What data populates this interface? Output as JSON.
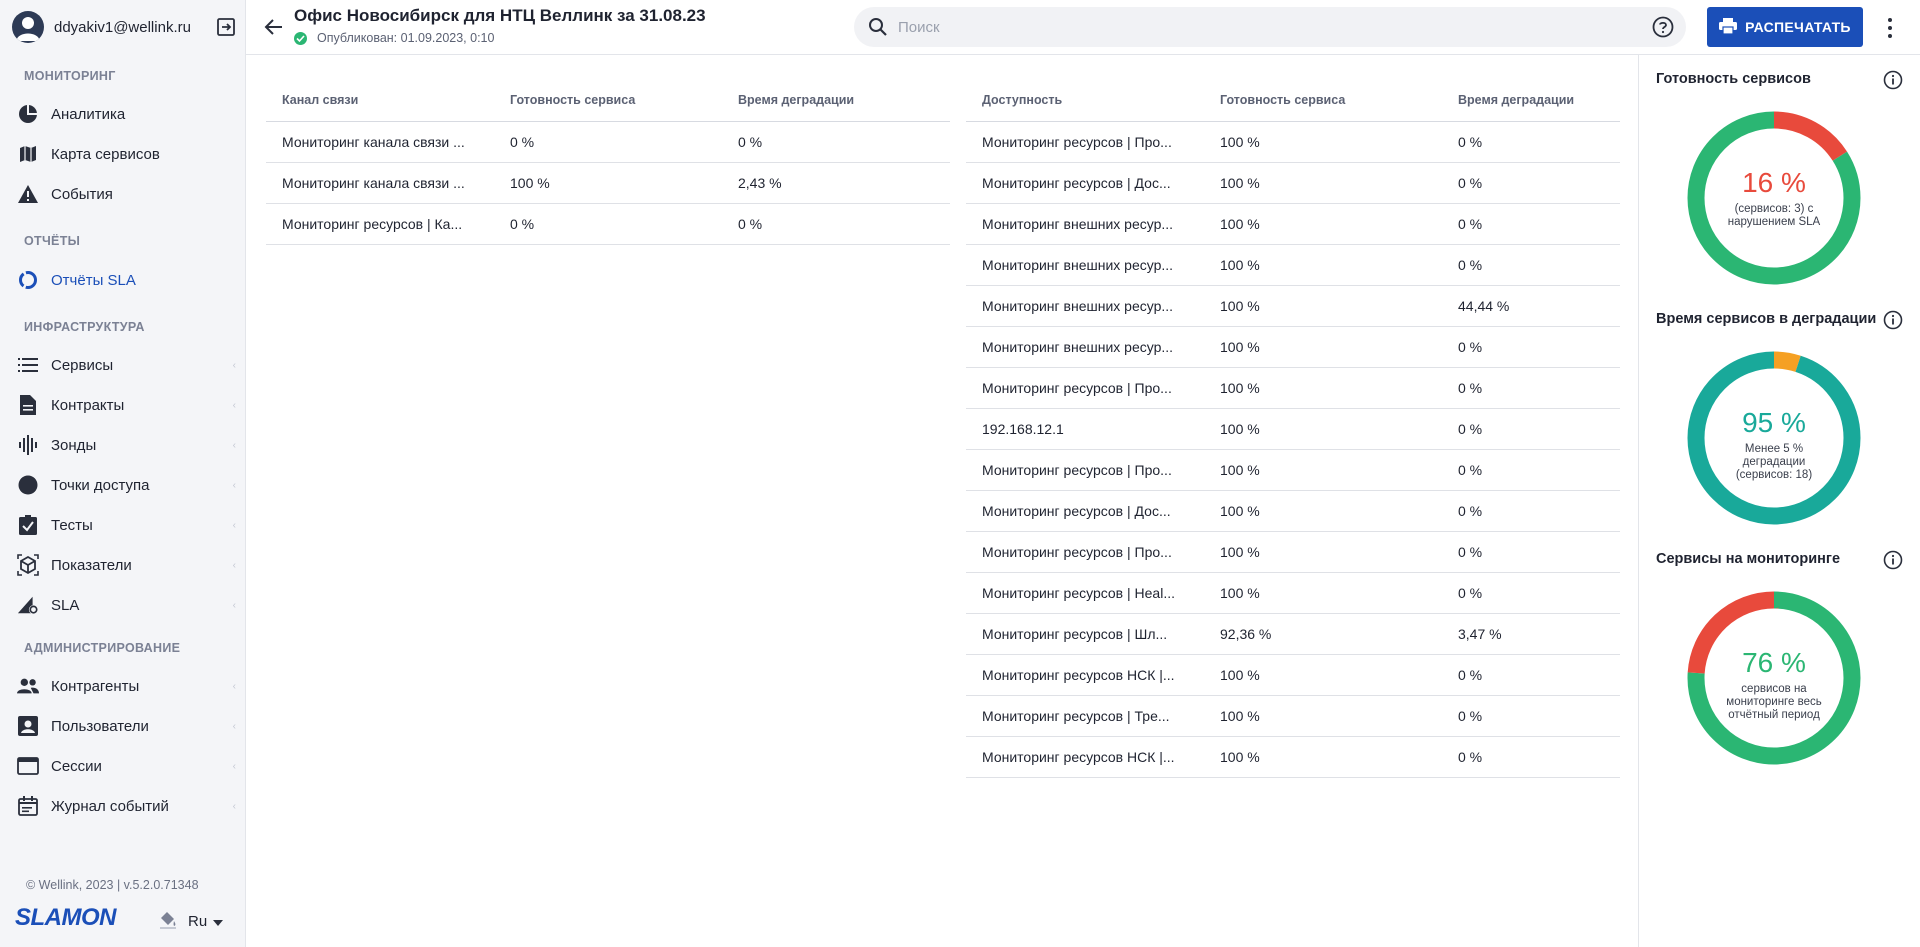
{
  "user": {
    "email": "ddyakiv1@wellink.ru"
  },
  "sidebar": {
    "sections": [
      {
        "title": "МОНИТОРИНГ",
        "items": [
          {
            "label": "Аналитика",
            "icon": "pie-chart-icon"
          },
          {
            "label": "Карта сервисов",
            "icon": "map-icon"
          },
          {
            "label": "События",
            "icon": "warning-icon"
          }
        ]
      },
      {
        "title": "ОТЧЁТЫ",
        "items": [
          {
            "label": "Отчёты SLA",
            "icon": "circle-progress-icon",
            "active": true
          }
        ]
      },
      {
        "title": "ИНФРАСТРУКТУРА",
        "items": [
          {
            "label": "Сервисы",
            "icon": "list-icon"
          },
          {
            "label": "Контракты",
            "icon": "document-icon"
          },
          {
            "label": "Зонды",
            "icon": "probe-icon"
          },
          {
            "label": "Точки доступа",
            "icon": "dot-icon"
          },
          {
            "label": "Тесты",
            "icon": "clipboard-check-icon"
          },
          {
            "label": "Показатели",
            "icon": "cube-icon"
          },
          {
            "label": "SLA",
            "icon": "sla-icon"
          }
        ]
      },
      {
        "title": "АДМИНИСТРИРОВАНИЕ",
        "items": [
          {
            "label": "Контрагенты",
            "icon": "people-icon"
          },
          {
            "label": "Пользователи",
            "icon": "user-badge-icon"
          },
          {
            "label": "Сессии",
            "icon": "window-icon"
          },
          {
            "label": "Журнал событий",
            "icon": "calendar-list-icon"
          }
        ]
      }
    ],
    "footer": {
      "copyright": "© Wellink, 2023 | v.5.2.0.71348",
      "logo": "SLAMON",
      "language": "Ru"
    }
  },
  "header": {
    "title": "Офис Новосибирск для НТЦ Веллинк за 31.08.23",
    "published": "Опубликован: 01.09.2023, 0:10",
    "search_placeholder": "Поиск",
    "print_label": "РАСПЕЧАТАТЬ"
  },
  "table_left": {
    "columns": [
      "Канал связи",
      "Готовность сервиса",
      "Время деградации"
    ],
    "rows": [
      [
        "Мониторинг канала связи ...",
        "0 %",
        "0 %"
      ],
      [
        "Мониторинг канала связи ...",
        "100 %",
        "2,43 %"
      ],
      [
        "Мониторинг ресурсов | Ка...",
        "0 %",
        "0 %"
      ]
    ]
  },
  "table_right": {
    "columns": [
      "Доступность",
      "Готовность сервиса",
      "Время деградации"
    ],
    "rows": [
      [
        "Мониторинг ресурсов | Про...",
        "100 %",
        "0 %"
      ],
      [
        "Мониторинг ресурсов | Дос...",
        "100 %",
        "0 %"
      ],
      [
        "Мониторинг внешних ресур...",
        "100 %",
        "0 %"
      ],
      [
        "Мониторинг внешних ресур...",
        "100 %",
        "0 %"
      ],
      [
        "Мониторинг внешних ресур...",
        "100 %",
        "44,44 %"
      ],
      [
        "Мониторинг внешних ресур...",
        "100 %",
        "0 %"
      ],
      [
        "Мониторинг ресурсов | Про...",
        "100 %",
        "0 %"
      ],
      [
        "192.168.12.1",
        "100 %",
        "0 %"
      ],
      [
        "Мониторинг ресурсов | Про...",
        "100 %",
        "0 %"
      ],
      [
        "Мониторинг ресурсов | Дос...",
        "100 %",
        "0 %"
      ],
      [
        "Мониторинг ресурсов | Про...",
        "100 %",
        "0 %"
      ],
      [
        "Мониторинг ресурсов | Heal...",
        "100 %",
        "0 %"
      ],
      [
        "Мониторинг ресурсов | Шл...",
        "92,36 %",
        "3,47 %"
      ],
      [
        "Мониторинг ресурсов НСК |...",
        "100 %",
        "0 %"
      ],
      [
        "Мониторинг ресурсов | Тре...",
        "100 %",
        "0 %"
      ],
      [
        "Мониторинг ресурсов НСК |...",
        "100 %",
        "0 %"
      ]
    ]
  },
  "cards": [
    {
      "title": "Готовность сервисов",
      "value": "16 %",
      "description": "(сервисов: 3) с нарушением SLA",
      "value_color": "#e84a3c",
      "segments": [
        {
          "fraction": 0.16,
          "color": "#e84a3c"
        },
        {
          "fraction": 0.84,
          "color": "#2bb673"
        }
      ]
    },
    {
      "title": "Время сервисов в деградации",
      "value": "95 %",
      "description": "Менее 5 % деградации (сервисов: 18)",
      "value_color": "#19a99a",
      "segments": [
        {
          "fraction": 0.05,
          "color": "#f5a023"
        },
        {
          "fraction": 0.95,
          "color": "#19a99a"
        }
      ]
    },
    {
      "title": "Сервисы на мониторинге",
      "value": "76 %",
      "description": "сервисов на мониторинге весь отчётный период",
      "value_color": "#2bb673",
      "segments": [
        {
          "fraction": 0.76,
          "color": "#2bb673"
        },
        {
          "fraction": 0.24,
          "color": "#e84a3c"
        }
      ]
    }
  ]
}
